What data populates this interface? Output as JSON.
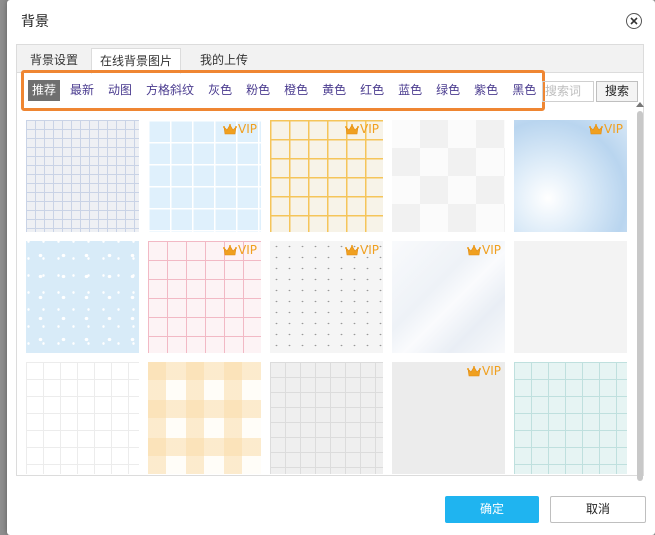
{
  "dialog": {
    "title": "背景",
    "ok_label": "确定",
    "cancel_label": "取消"
  },
  "tabs": [
    {
      "label": "背景设置"
    },
    {
      "label": "在线背景图片"
    },
    {
      "label": "我的上传"
    }
  ],
  "categories": [
    {
      "label": "推荐",
      "active": true
    },
    {
      "label": "最新"
    },
    {
      "label": "动图"
    },
    {
      "label": "方格斜纹"
    },
    {
      "label": "灰色"
    },
    {
      "label": "粉色"
    },
    {
      "label": "橙色"
    },
    {
      "label": "黄色"
    },
    {
      "label": "红色"
    },
    {
      "label": "蓝色"
    },
    {
      "label": "绿色"
    },
    {
      "label": "紫色"
    },
    {
      "label": "黑色"
    }
  ],
  "search": {
    "placeholder": "搜索词",
    "button_label": "搜索"
  },
  "thumbnails": [
    {
      "pattern": "grid-gray-blue",
      "vip": false
    },
    {
      "pattern": "grid-light-blue",
      "vip": true
    },
    {
      "pattern": "grid-yellow",
      "vip": true
    },
    {
      "pattern": "white-checker",
      "vip": false
    },
    {
      "pattern": "watercolor-blue",
      "vip": true
    },
    {
      "pattern": "snow-blue",
      "vip": false
    },
    {
      "pattern": "grid-pink",
      "vip": true
    },
    {
      "pattern": "speckle-gray",
      "vip": true
    },
    {
      "pattern": "marble-white",
      "vip": true
    },
    {
      "pattern": "plain-light-gray",
      "vip": false
    },
    {
      "pattern": "grid-white",
      "vip": false
    },
    {
      "pattern": "plaid-orange",
      "vip": false
    },
    {
      "pattern": "grid-gray",
      "vip": false
    },
    {
      "pattern": "dotted-grid-gray",
      "vip": true
    },
    {
      "pattern": "grid-teal",
      "vip": false
    }
  ],
  "vip_label": "VIP",
  "colors": {
    "accent": "#1fb4f0",
    "highlight_outline": "#ef8632",
    "category_text": "#4a3b8f",
    "active_category_bg": "#6f6f6f",
    "vip": "#f0a020"
  }
}
